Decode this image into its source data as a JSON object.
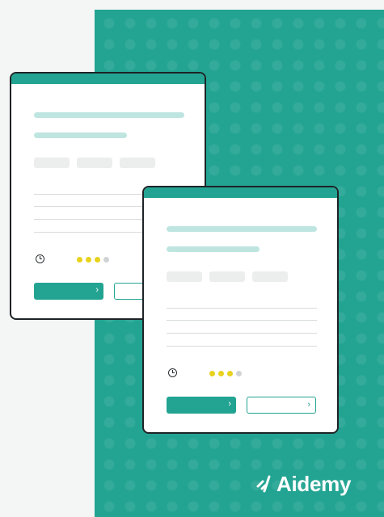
{
  "colors": {
    "brand": "#23a492",
    "card_header": "#23a492",
    "bar_light": "#bfe5e1",
    "chip": "#eceeee",
    "dot_active": "#e8d21d",
    "dot_inactive": "#cfd3d3",
    "border": "#1d2326"
  },
  "brand": {
    "name": "Aidemy",
    "logo_icon": "aidemy-mark-icon"
  },
  "cards": [
    {
      "icon": "clock-icon",
      "progress_filled": 3,
      "progress_total": 4,
      "primary_chevron": "›",
      "outline_chevron": "›"
    },
    {
      "icon": "clock-icon",
      "progress_filled": 3,
      "progress_total": 4,
      "primary_chevron": "›",
      "outline_chevron": "›"
    }
  ]
}
